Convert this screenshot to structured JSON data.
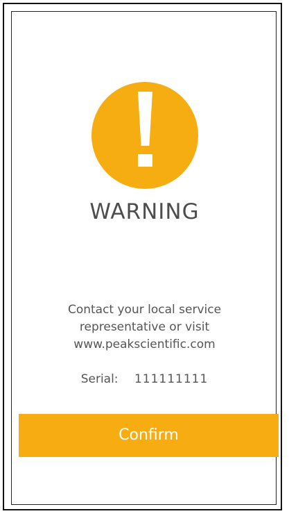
{
  "alert": {
    "icon": "warning-exclamation-icon",
    "title": "WARNING",
    "message_lines": [
      "Contact your local service",
      "representative or visit",
      "www.peakscientific.com"
    ],
    "serial_label": "Serial:",
    "serial_value": "111111111",
    "confirm_label": "Confirm"
  },
  "colors": {
    "accent": "#f5ad11",
    "button": "#f7ad12",
    "text": "#555555",
    "background": "#ffffff"
  }
}
